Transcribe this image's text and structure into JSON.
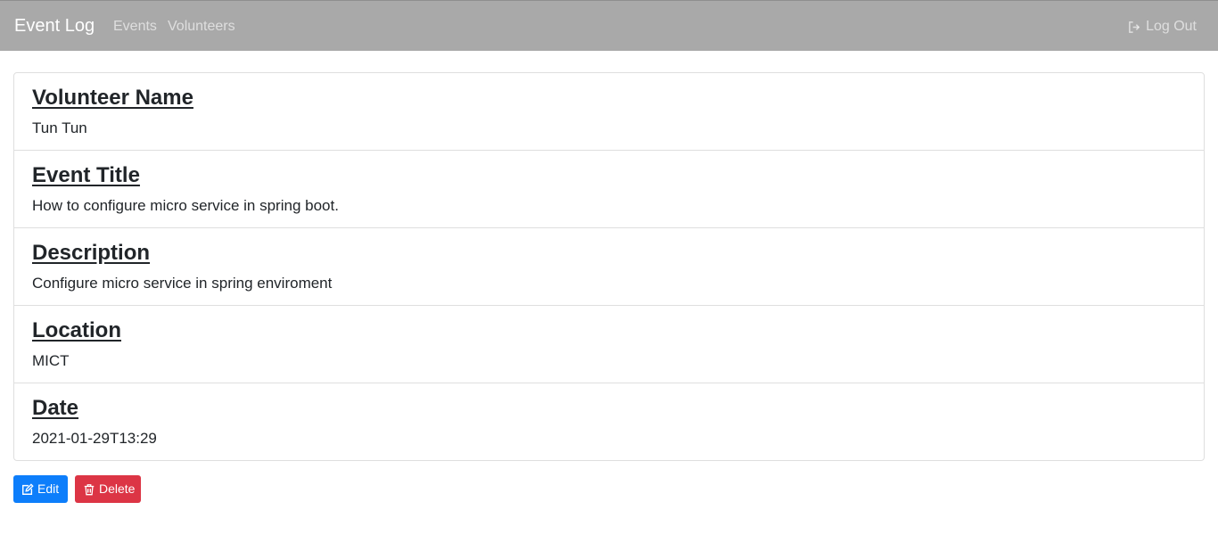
{
  "navbar": {
    "brand": "Event Log",
    "links": [
      "Events",
      "Volunteers"
    ],
    "logout_label": "Log Out"
  },
  "details": [
    {
      "title": "Volunteer Name",
      "value": "Tun Tun"
    },
    {
      "title": "Event Title",
      "value": "How to configure micro service in spring boot."
    },
    {
      "title": "Description",
      "value": "Configure micro service in spring enviroment"
    },
    {
      "title": "Location",
      "value": "MICT"
    },
    {
      "title": "Date",
      "value": "2021-01-29T13:29"
    }
  ],
  "actions": {
    "edit_label": "Edit",
    "delete_label": "Delete"
  },
  "icons": {
    "logout": "sign-out-icon",
    "edit": "edit-icon",
    "delete": "trash-icon"
  },
  "colors": {
    "navbar_bg": "#a9a9a9",
    "edit_button": "#0d7efb",
    "delete_button": "#dc3545"
  }
}
